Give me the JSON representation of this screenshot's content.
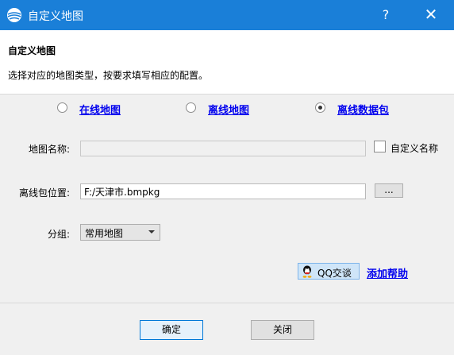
{
  "window": {
    "title": "自定义地图",
    "help_glyph": "?",
    "close_glyph": "✕"
  },
  "header": {
    "title": "自定义地图",
    "description": "选择对应的地图类型，按要求填写相应的配置。"
  },
  "map_type": {
    "options": [
      {
        "label": "在线地图",
        "selected": false
      },
      {
        "label": "离线地图",
        "selected": false
      },
      {
        "label": "离线数据包",
        "selected": true
      }
    ]
  },
  "form": {
    "map_name": {
      "label": "地图名称:",
      "value": "",
      "disabled": true
    },
    "custom_name": {
      "label": "自定义名称",
      "checked": false
    },
    "package_path": {
      "label": "离线包位置:",
      "value": "F:/天津市.bmpkg",
      "browse_label": "..."
    },
    "group": {
      "label": "分组:",
      "selected": "常用地图"
    }
  },
  "support": {
    "qq_label": "QQ交谈",
    "help_link": "添加帮助"
  },
  "footer": {
    "ok_label": "确定",
    "close_label": "关闭"
  },
  "colors": {
    "titlebar": "#1a7fd8",
    "link": "#0000ee"
  }
}
